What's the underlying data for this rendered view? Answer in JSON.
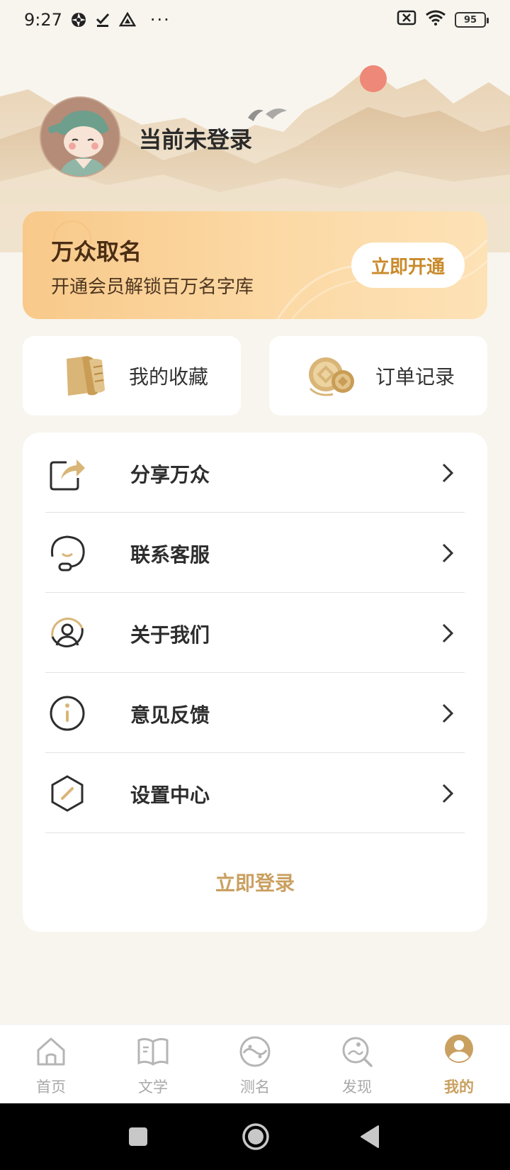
{
  "status_bar": {
    "time": "9:27",
    "dots": "···",
    "battery": "95",
    "icons": [
      "aperture-icon",
      "check-download-icon",
      "drive-icon",
      "sim-off-icon",
      "wifi-icon",
      "battery-icon"
    ]
  },
  "header": {
    "login_status": "当前未登录"
  },
  "vip": {
    "title": "万众取名",
    "subtitle": "开通会员解锁百万名字库",
    "button": "立即开通"
  },
  "tiles": [
    {
      "label": "我的收藏",
      "icon": "scroll-icon"
    },
    {
      "label": "订单记录",
      "icon": "coins-icon"
    }
  ],
  "menu": {
    "items": [
      {
        "label": "分享万众",
        "icon": "share-icon"
      },
      {
        "label": "联系客服",
        "icon": "customer-service-icon"
      },
      {
        "label": "关于我们",
        "icon": "user-circle-icon"
      },
      {
        "label": "意见反馈",
        "icon": "info-icon"
      },
      {
        "label": "设置中心",
        "icon": "settings-hexagon-icon"
      }
    ],
    "login_link": "立即登录"
  },
  "bottom_nav": {
    "items": [
      {
        "label": "首页",
        "icon": "home-icon"
      },
      {
        "label": "文学",
        "icon": "book-icon"
      },
      {
        "label": "测名",
        "icon": "yin-yang-icon"
      },
      {
        "label": "发现",
        "icon": "discover-icon"
      },
      {
        "label": "我的",
        "icon": "profile-icon"
      }
    ],
    "active_index": 4
  },
  "colors": {
    "background": "#f8f5ee",
    "accent": "#c9a060",
    "vip_gradient_start": "#f8c98a",
    "vip_gradient_end": "#fde2b6",
    "vip_button_text": "#c98a2a",
    "inactive_nav": "#a8a8a8"
  }
}
